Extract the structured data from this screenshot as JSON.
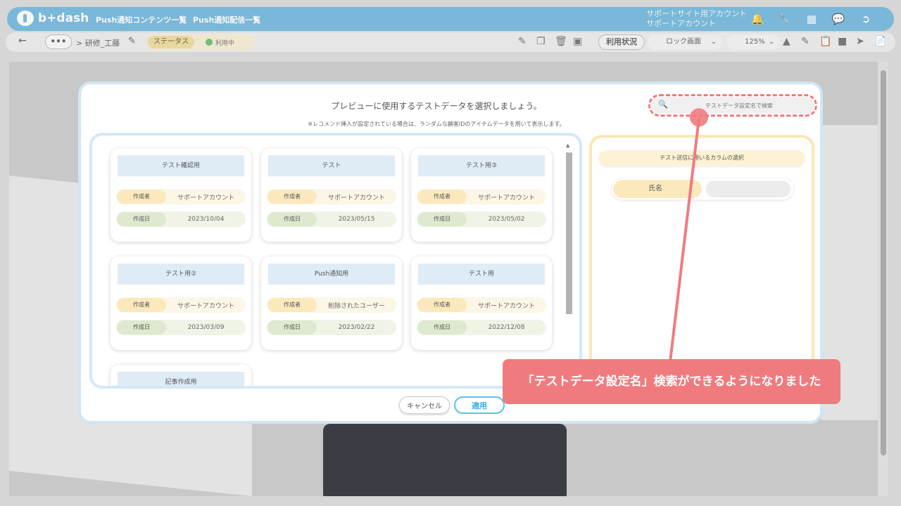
{
  "header": {
    "logo_text": "b+dash",
    "nav": [
      "Push通知コンテンツ一覧",
      "Push通知配信一覧"
    ],
    "account_line1": "サポートサイト用アカウント",
    "account_line2": "サポートアカウント",
    "icons": [
      "bell-icon",
      "wrench-icon",
      "grid-icon",
      "chat-icon",
      "logout-icon"
    ]
  },
  "toolbar": {
    "back": "←",
    "dots": "•••",
    "breadcrumb": "> 研修_工藤",
    "status_label": "ステータス",
    "status_value": "利用中",
    "usage_button": "利用状況",
    "lock_select": "ロック画面",
    "zoom_select": "125%"
  },
  "modal": {
    "title": "プレビューに使用するテストデータを選択しましょう。",
    "note": "※レコメンド挿入が設定されている場合は、ランダムな顧客IDのアイテムデータを用いて表示します。",
    "search_placeholder": "テストデータ設定名で検索",
    "cards": [
      {
        "name": "テスト確認用",
        "creator_label": "作成者",
        "creator": "サポートアカウント",
        "date_label": "作成日",
        "date": "2023/10/04"
      },
      {
        "name": "テスト",
        "creator_label": "作成者",
        "creator": "サポートアカウント",
        "date_label": "作成日",
        "date": "2023/05/15"
      },
      {
        "name": "テスト用③",
        "creator_label": "作成者",
        "creator": "サポートアカウント",
        "date_label": "作成日",
        "date": "2023/05/02"
      },
      {
        "name": "テスト用②",
        "creator_label": "作成者",
        "creator": "サポートアカウント",
        "date_label": "作成日",
        "date": "2023/03/09"
      },
      {
        "name": "Push通知用",
        "creator_label": "作成者",
        "creator": "削除されたユーザー",
        "date_label": "作成日",
        "date": "2023/02/22"
      },
      {
        "name": "テスト用",
        "creator_label": "作成者",
        "creator": "サポートアカウント",
        "date_label": "作成日",
        "date": "2022/12/08"
      },
      {
        "name": "記事作成用",
        "creator_label": "",
        "creator": "",
        "date_label": "",
        "date": ""
      }
    ],
    "column_panel_title": "テスト送信に用いるカラムの選択",
    "column_name": "氏名",
    "cancel_button": "キャンセル",
    "apply_button": "適用"
  },
  "annotation": {
    "callout": "「テストデータ設定名」検索ができるようになりました",
    "color": "#f07b7f"
  }
}
